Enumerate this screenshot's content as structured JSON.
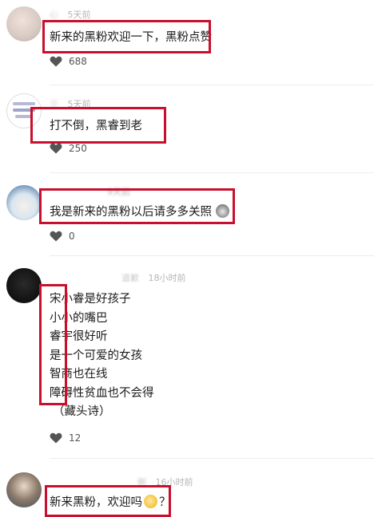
{
  "colors": {
    "highlight": "#c8102e",
    "meta": "#b6b6b6",
    "text": "#1a1a1a",
    "divider": "#ededed"
  },
  "comments": [
    {
      "name": "心",
      "time": "5天前",
      "text": "新来的黑粉欢迎一下，黑粉点赞",
      "likes": "688",
      "avatar_icon": "user-avatar-icon"
    },
    {
      "name": "兰",
      "time": "5天前",
      "text": "打不倒，黑睿到老",
      "likes": "250",
      "avatar_icon": "user-avatar-icon"
    },
    {
      "name": "",
      "time": "9天前",
      "text": "我是新来的黑粉以后请多多关照",
      "likes": "0",
      "avatar_icon": "user-avatar-icon",
      "emoji": "cat-emoji-icon"
    },
    {
      "name": "道歉",
      "time": "18小时前",
      "lines": [
        "宋小睿是好孩子",
        "小小的嘴巴",
        "睿宇很好听",
        "是一个可爱的女孩",
        "智商也在线",
        "障碍性贫血也不会得",
        "（藏头诗）"
      ],
      "likes": "12",
      "avatar_icon": "user-avatar-icon"
    },
    {
      "name": "鲥",
      "time": "16小时前",
      "text": "新来黑粉，欢迎吗",
      "text_suffix": "？",
      "likes": "",
      "avatar_icon": "user-avatar-icon",
      "emoji": "clap-emoji-icon"
    }
  ]
}
